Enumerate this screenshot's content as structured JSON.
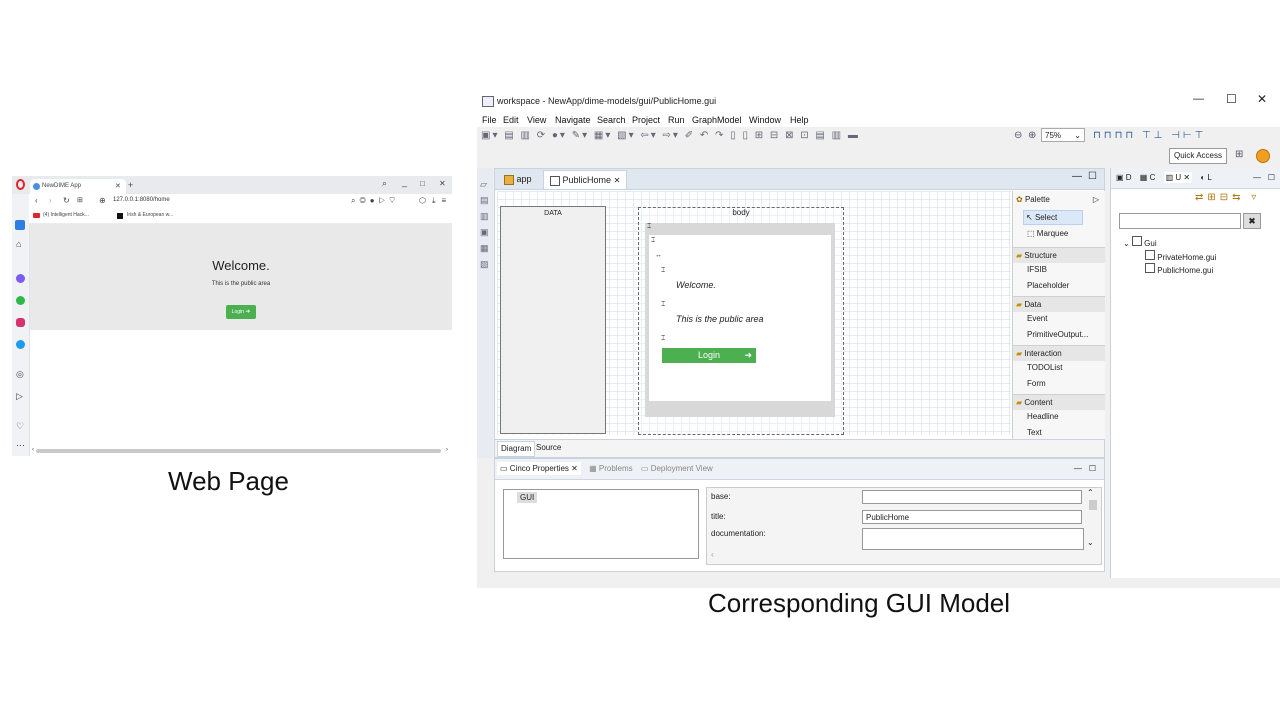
{
  "browser": {
    "tab_title": "NewDIME App",
    "new_tab": "+",
    "address": "127.0.0.1:8080/home",
    "bookmarks": [
      "(4) Intelligent Hack...",
      "Irish & European w..."
    ],
    "welcome": "Welcome.",
    "public_text": "This is the public area",
    "login_button": "Login",
    "controls": {
      "min": "_",
      "max": "□",
      "close": "✕"
    }
  },
  "caption_left": "Web Page",
  "caption_right": "Corresponding GUI Model",
  "eclipse": {
    "title": "workspace - NewApp/dime-models/gui/PublicHome.gui",
    "window_controls": {
      "min": "—",
      "max": "☐",
      "close": "✕"
    },
    "menu": [
      "File",
      "Edit",
      "View",
      "Navigate",
      "Search",
      "Project",
      "Run",
      "GraphModel",
      "Window",
      "Help"
    ],
    "zoom": "75%",
    "quick_access": "Quick Access",
    "tabs": {
      "app": "app",
      "public_home": "PublicHome"
    },
    "canvas": {
      "data_label": "DATA",
      "body_label": "body",
      "welcome": "Welcome.",
      "public_text": "This is the public area",
      "login": "Login"
    },
    "palette": {
      "title": "Palette",
      "top_items": [
        "Select",
        "Marquee"
      ],
      "sections": [
        {
          "name": "Structure",
          "items": [
            "IFSIB",
            "Placeholder"
          ]
        },
        {
          "name": "Data",
          "items": [
            "Event",
            "PrimitiveOutput..."
          ]
        },
        {
          "name": "Interaction",
          "items": [
            "TODOList",
            "Form"
          ]
        },
        {
          "name": "Content",
          "items": [
            "Headline",
            "Text"
          ]
        }
      ]
    },
    "bottom_tabs": [
      "Diagram",
      "Source"
    ],
    "right_panel": {
      "tabs": [
        "D",
        "C",
        "U",
        "L"
      ],
      "tree_root": "Gui",
      "tree_items": [
        "PrivateHome.gui",
        "PublicHome.gui"
      ]
    },
    "props": {
      "tabs": [
        "Cinco Properties",
        "Problems",
        "Deployment View"
      ],
      "tree_item": "GUI",
      "fields": [
        {
          "label": "base:",
          "value": ""
        },
        {
          "label": "title:",
          "value": "PublicHome"
        },
        {
          "label": "documentation:",
          "value": ""
        }
      ]
    }
  }
}
